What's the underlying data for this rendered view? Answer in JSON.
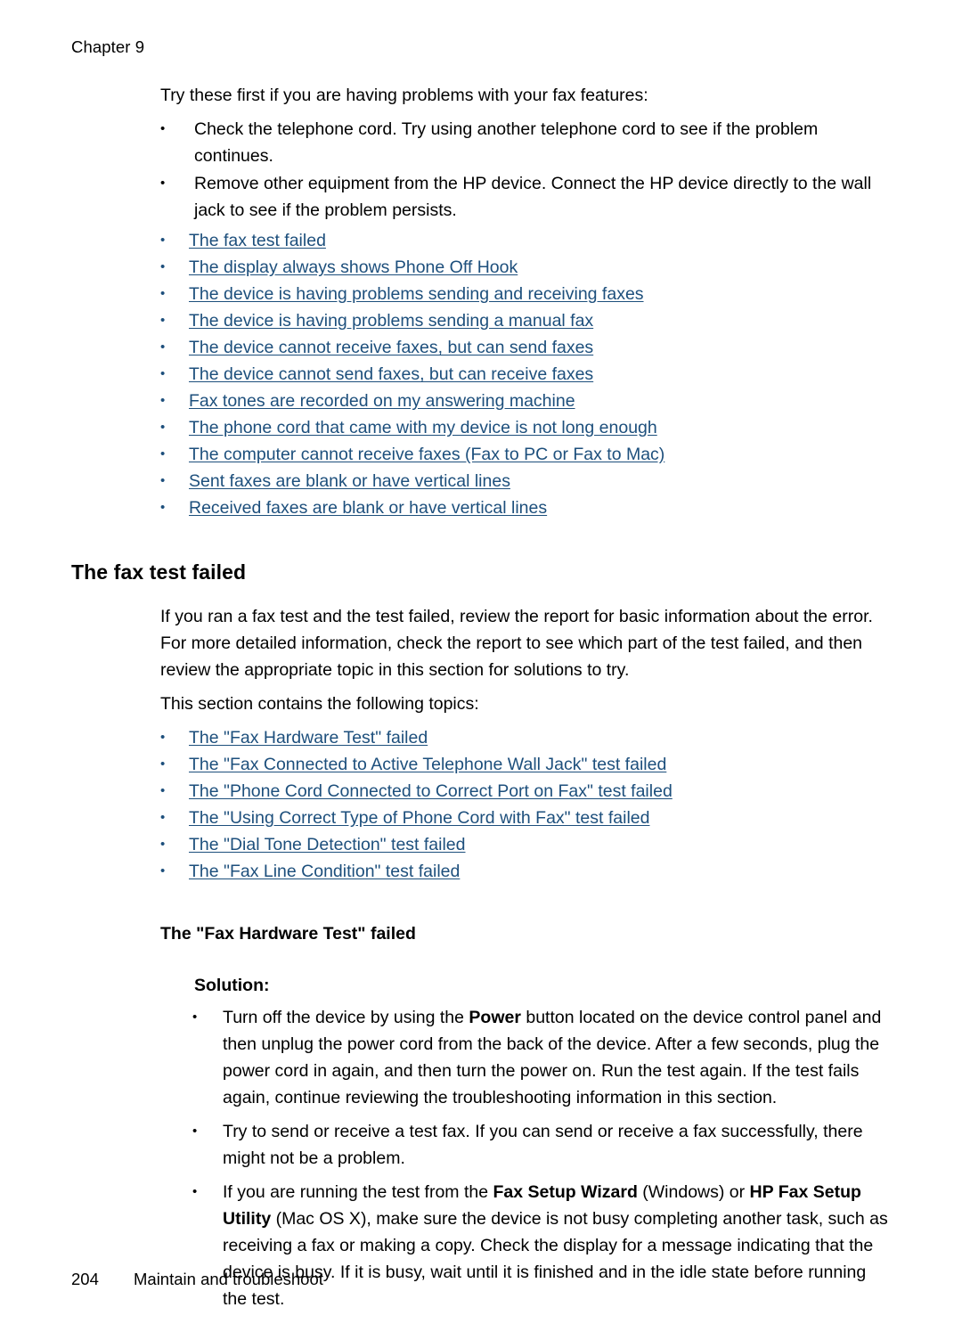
{
  "header": {
    "chapter_label": "Chapter 9"
  },
  "intro": {
    "lead_paragraph": "Try these first if you are having problems with your fax features:",
    "bullets": [
      "Check the telephone cord. Try using another telephone cord to see if the problem continues.",
      "Remove other equipment from the HP device. Connect the HP device directly to the wall jack to see if the problem persists."
    ],
    "links": [
      "The fax test failed",
      "The display always shows Phone Off Hook",
      "The device is having problems sending and receiving faxes",
      "The device is having problems sending a manual fax",
      "The device cannot receive faxes, but can send faxes",
      "The device cannot send faxes, but can receive faxes",
      "Fax tones are recorded on my answering machine",
      "The phone cord that came with my device is not long enough",
      "The computer cannot receive faxes (Fax to PC or Fax to Mac)",
      "Sent faxes are blank or have vertical lines",
      "Received faxes are blank or have vertical lines"
    ]
  },
  "section": {
    "title": "The fax test failed",
    "paragraph_1": "If you ran a fax test and the test failed, review the report for basic information about the error. For more detailed information, check the report to see which part of the test failed, and then review the appropriate topic in this section for solutions to try.",
    "paragraph_2": "This section contains the following topics:",
    "links": [
      "The \"Fax Hardware Test\" failed",
      "The \"Fax Connected to Active Telephone Wall Jack\" test failed",
      "The \"Phone Cord Connected to Correct Port on Fax\" test failed",
      "The \"Using Correct Type of Phone Cord with Fax\" test failed",
      "The \"Dial Tone Detection\" test failed",
      "The \"Fax Line Condition\" test failed"
    ]
  },
  "subsection": {
    "title": "The \"Fax Hardware Test\" failed",
    "solution_label": "Solution:",
    "solution_bullets": [
      {
        "segments": [
          {
            "text": "Turn off the device by using the ",
            "bold": false
          },
          {
            "text": "Power",
            "bold": true
          },
          {
            "text": " button located on the device control panel and then unplug the power cord from the back of the device. After a few seconds, plug the power cord in again, and then turn the power on. Run the test again. If the test fails again, continue reviewing the troubleshooting information in this section.",
            "bold": false
          }
        ]
      },
      {
        "segments": [
          {
            "text": "Try to send or receive a test fax. If you can send or receive a fax successfully, there might not be a problem.",
            "bold": false
          }
        ]
      },
      {
        "segments": [
          {
            "text": "If you are running the test from the ",
            "bold": false
          },
          {
            "text": "Fax Setup Wizard",
            "bold": true
          },
          {
            "text": " (Windows) or ",
            "bold": false
          },
          {
            "text": "HP Fax Setup Utility",
            "bold": true
          },
          {
            "text": " (Mac OS X), make sure the device is not busy completing another task, such as receiving a fax or making a copy. Check the display for a message indicating that the device is busy. If it is busy, wait until it is finished and in the idle state before running the test.",
            "bold": false
          }
        ]
      }
    ]
  },
  "footer": {
    "page_number": "204",
    "running_title": "Maintain and troubleshoot"
  },
  "colors": {
    "link": "#1d4f7c",
    "text": "#000000",
    "background": "#ffffff"
  }
}
